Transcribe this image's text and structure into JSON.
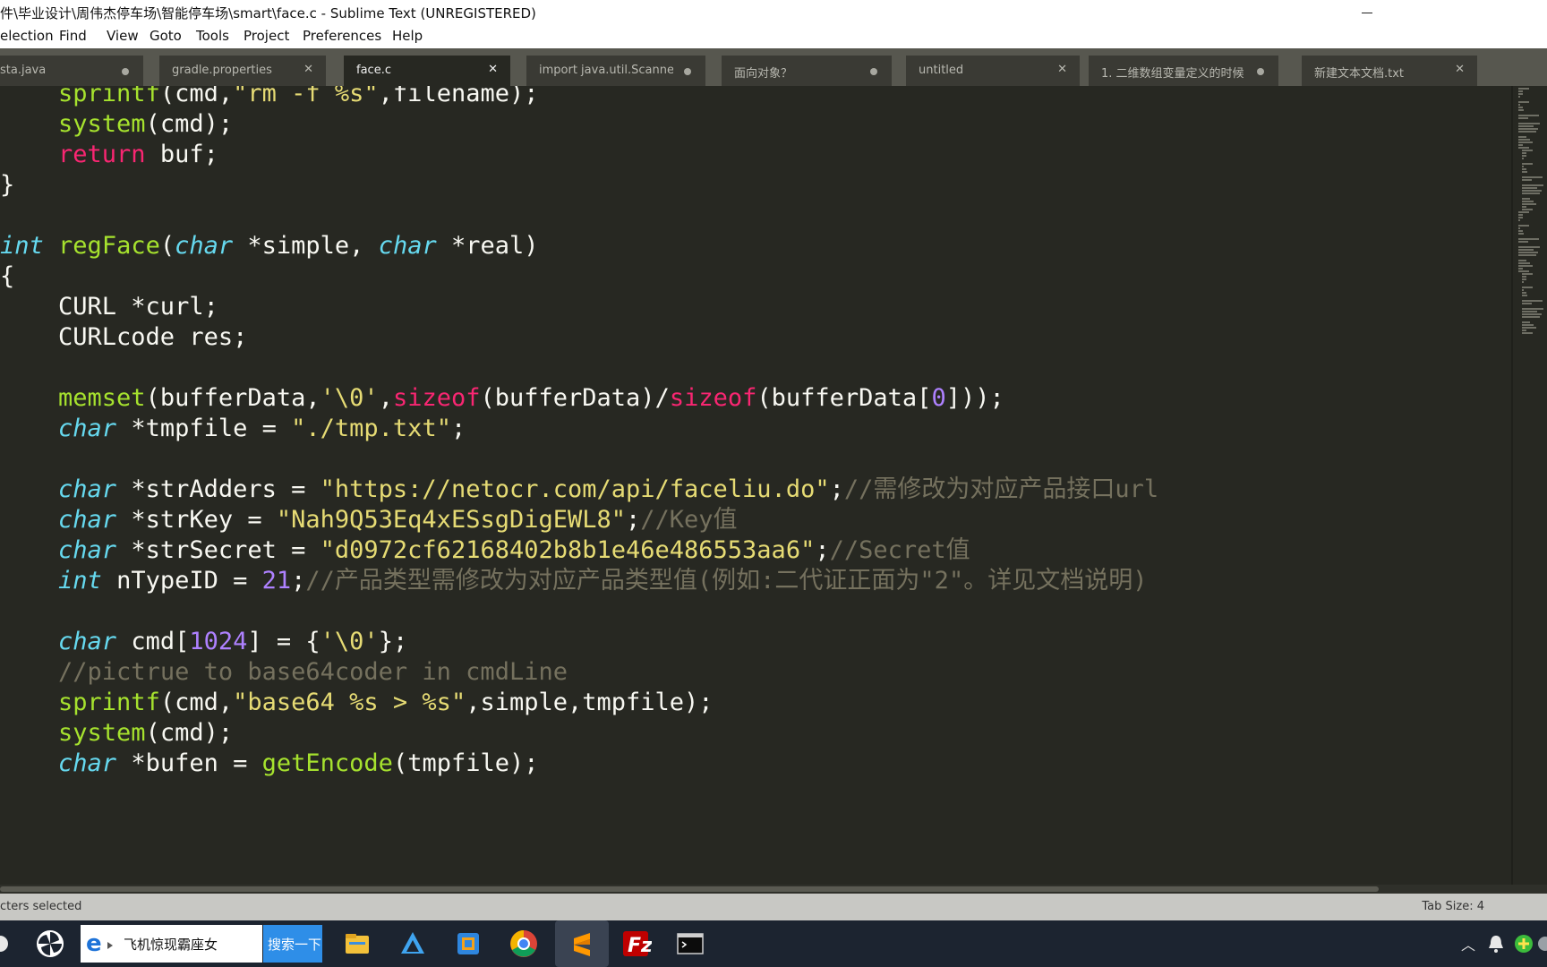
{
  "window": {
    "title": "件\\毕业设计\\周伟杰停车场\\智能停车场\\smart\\face.c - Sublime Text (UNREGISTERED)"
  },
  "menu": [
    "election",
    "Find",
    "View",
    "Goto",
    "Tools",
    "Project",
    "Preferences",
    "Help"
  ],
  "tabs": [
    {
      "label": "sta.java",
      "state": "dirty"
    },
    {
      "label": "gradle.properties",
      "state": "close"
    },
    {
      "label": "face.c",
      "state": "active"
    },
    {
      "label": "import java.util.Scanner;",
      "state": "dirty"
    },
    {
      "label": "面向对象？",
      "state": "dirty"
    },
    {
      "label": "untitled",
      "state": "close"
    },
    {
      "label": "1. 二维数组变量定义的时候",
      "state": "dirty"
    },
    {
      "label": "新建文本文档.txt",
      "state": "close"
    }
  ],
  "code": [
    [
      [
        "    ",
        ""
      ],
      [
        "sprintf",
        "fn"
      ],
      [
        "(cmd,",
        ""
      ],
      [
        "\"rm -f %s\"",
        "str"
      ],
      [
        ",filename);",
        ""
      ]
    ],
    [
      [
        "    ",
        ""
      ],
      [
        "system",
        "fn"
      ],
      [
        "(cmd);",
        ""
      ]
    ],
    [
      [
        "    ",
        ""
      ],
      [
        "return",
        "kw"
      ],
      [
        " buf;",
        ""
      ]
    ],
    [
      [
        "}",
        ""
      ]
    ],
    [],
    [
      [
        "int",
        "typ"
      ],
      [
        " ",
        ""
      ],
      [
        "regFace",
        "fn"
      ],
      [
        "(",
        ""
      ],
      [
        "char",
        "typ"
      ],
      [
        " *simple, ",
        ""
      ],
      [
        "char",
        "typ"
      ],
      [
        " *real)",
        ""
      ]
    ],
    [
      [
        "{",
        ""
      ]
    ],
    [
      [
        "    CURL *curl;",
        ""
      ]
    ],
    [
      [
        "    CURLcode res;",
        ""
      ]
    ],
    [],
    [
      [
        "    ",
        ""
      ],
      [
        "memset",
        "fn"
      ],
      [
        "(bufferData,",
        ""
      ],
      [
        "'\\0'",
        "str"
      ],
      [
        ",",
        ""
      ],
      [
        "sizeof",
        "kw"
      ],
      [
        "(bufferData)/",
        ""
      ],
      [
        "sizeof",
        "kw"
      ],
      [
        "(bufferData[",
        ""
      ],
      [
        "0",
        "num"
      ],
      [
        "]));",
        ""
      ]
    ],
    [
      [
        "    ",
        ""
      ],
      [
        "char",
        "typ"
      ],
      [
        " *tmpfile = ",
        ""
      ],
      [
        "\"./tmp.txt\"",
        "str"
      ],
      [
        ";",
        ""
      ]
    ],
    [],
    [
      [
        "    ",
        ""
      ],
      [
        "char",
        "typ"
      ],
      [
        " *strAdders = ",
        ""
      ],
      [
        "\"https://netocr.com/api/faceliu.do\"",
        "str"
      ],
      [
        ";",
        ""
      ],
      [
        "//需修改为对应产品接口url",
        "cm"
      ]
    ],
    [
      [
        "    ",
        ""
      ],
      [
        "char",
        "typ"
      ],
      [
        " *strKey = ",
        ""
      ],
      [
        "\"Nah9Q53Eq4xESsgDigEWL8\"",
        "str"
      ],
      [
        ";",
        ""
      ],
      [
        "//Key值",
        "cm"
      ]
    ],
    [
      [
        "    ",
        ""
      ],
      [
        "char",
        "typ"
      ],
      [
        " *strSecret = ",
        ""
      ],
      [
        "\"d0972cf62168402b8b1e46e486553aa6\"",
        "str"
      ],
      [
        ";",
        ""
      ],
      [
        "//Secret值",
        "cm"
      ]
    ],
    [
      [
        "    ",
        ""
      ],
      [
        "int",
        "typ"
      ],
      [
        " nTypeID = ",
        ""
      ],
      [
        "21",
        "num"
      ],
      [
        ";",
        ""
      ],
      [
        "//产品类型需修改为对应产品类型值(例如:二代证正面为\"2\"。详见文档说明)",
        "cm"
      ]
    ],
    [],
    [
      [
        "    ",
        ""
      ],
      [
        "char",
        "typ"
      ],
      [
        " cmd[",
        ""
      ],
      [
        "1024",
        "num"
      ],
      [
        "] = {",
        ""
      ],
      [
        "'\\0'",
        "str"
      ],
      [
        "};",
        ""
      ]
    ],
    [
      [
        "    ",
        ""
      ],
      [
        "//pictrue to base64coder in cmdLine",
        "cm"
      ]
    ],
    [
      [
        "    ",
        ""
      ],
      [
        "sprintf",
        "fn"
      ],
      [
        "(cmd,",
        ""
      ],
      [
        "\"base64 %s > %s\"",
        "str"
      ],
      [
        ",simple,tmpfile);",
        ""
      ]
    ],
    [
      [
        "    ",
        ""
      ],
      [
        "system",
        "fn"
      ],
      [
        "(cmd);",
        ""
      ]
    ],
    [
      [
        "    ",
        ""
      ],
      [
        "char",
        "typ"
      ],
      [
        " *bufen = ",
        ""
      ],
      [
        "getEncode",
        "fn"
      ],
      [
        "(tmpfile);",
        ""
      ]
    ]
  ],
  "status": {
    "left": "cters selected",
    "right": "Tab Size: 4"
  },
  "taskbar": {
    "search_text": "飞机惊现霸座女",
    "search_button": "搜索一下"
  },
  "colors": {
    "bg": "#272822",
    "keyword": "#f92672",
    "type": "#66d9ef",
    "function": "#a6e22e",
    "string": "#e6db74",
    "number": "#ae81ff",
    "comment": "#75715e"
  }
}
